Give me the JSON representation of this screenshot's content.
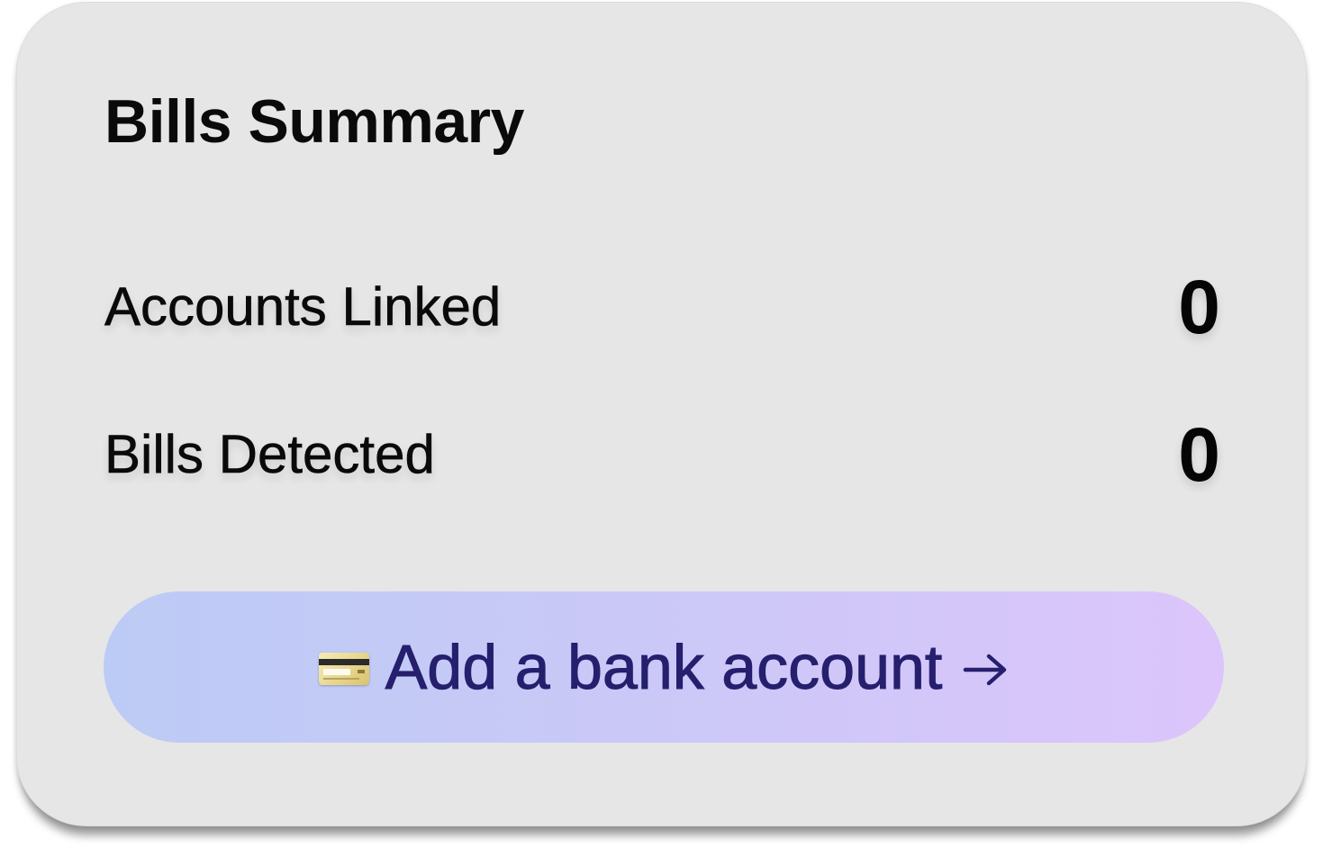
{
  "card": {
    "title": "Bills Summary",
    "rows": [
      {
        "label": "Accounts Linked",
        "value": "0"
      },
      {
        "label": "Bills Detected",
        "value": "0"
      }
    ],
    "cta": {
      "icon": "credit-card-icon",
      "label": "Add a bank account",
      "trailing_icon": "arrow-right-icon"
    }
  },
  "colors": {
    "card_background": "#e6e6e6",
    "text_primary": "#0a0a0a",
    "cta_text": "#251f6e",
    "cta_gradient_start": "#bccbf5",
    "cta_gradient_end": "#dcc5fb"
  }
}
